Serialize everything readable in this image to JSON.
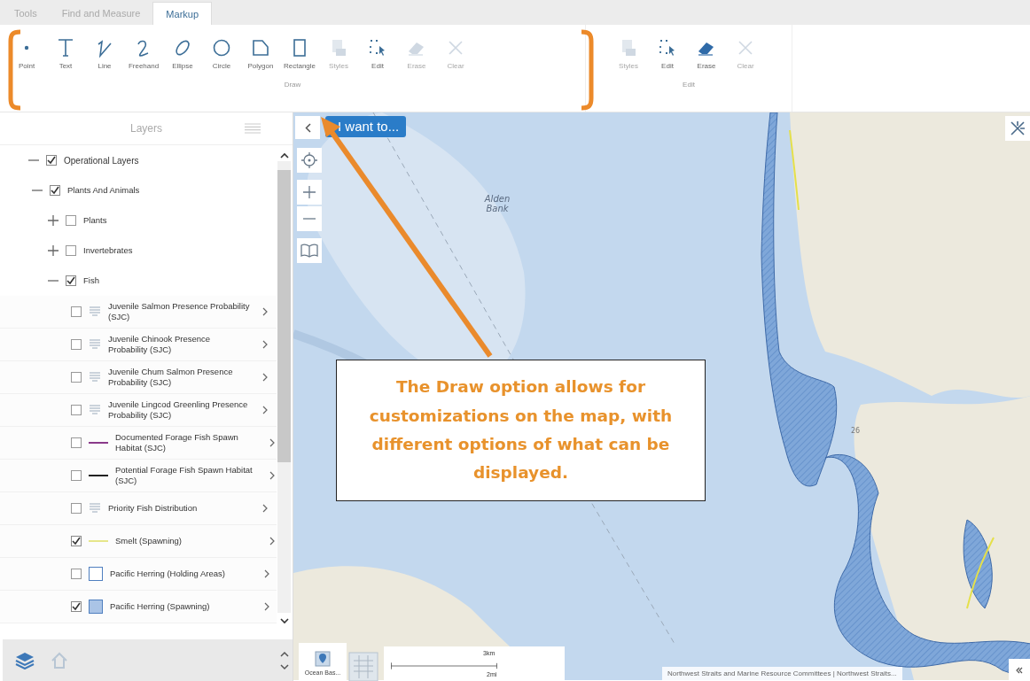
{
  "tabs": [
    {
      "label": "Tools",
      "selected": false
    },
    {
      "label": "Find and Measure",
      "selected": false
    },
    {
      "label": "Markup",
      "selected": true
    }
  ],
  "ribbon_groups": [
    {
      "label": "Draw",
      "buttons": [
        {
          "kind": "point",
          "label": "Point",
          "disabled": false
        },
        {
          "kind": "text",
          "label": "Text",
          "disabled": false
        },
        {
          "kind": "line",
          "label": "Line",
          "disabled": false
        },
        {
          "kind": "freehand",
          "label": "Freehand",
          "disabled": false
        },
        {
          "kind": "ellipse",
          "label": "Ellipse",
          "disabled": false
        },
        {
          "kind": "circle",
          "label": "Circle",
          "disabled": false
        },
        {
          "kind": "polygon",
          "label": "Polygon",
          "disabled": false
        },
        {
          "kind": "rectangle",
          "label": "Rectangle",
          "disabled": false
        },
        {
          "kind": "styles",
          "label": "Styles",
          "disabled": true
        },
        {
          "kind": "edit",
          "label": "Edit",
          "disabled": false
        },
        {
          "kind": "erase",
          "label": "Erase",
          "disabled": true
        },
        {
          "kind": "clear",
          "label": "Clear",
          "disabled": true
        }
      ]
    },
    {
      "label": "Edit",
      "buttons": [
        {
          "kind": "styles",
          "label": "Styles",
          "disabled": true
        },
        {
          "kind": "edit",
          "label": "Edit",
          "disabled": false
        },
        {
          "kind": "erase",
          "label": "Erase",
          "disabled": false
        },
        {
          "kind": "clear",
          "label": "Clear",
          "disabled": true
        }
      ]
    }
  ],
  "layers_panel": {
    "title": "Layers",
    "tree": [
      {
        "label": "Operational Layers",
        "checked": true,
        "expanded": true,
        "children": [
          {
            "label": "Plants And Animals",
            "checked": true,
            "expanded": true,
            "children": [
              {
                "label": "Plants",
                "checked": false,
                "expanded": false
              },
              {
                "label": "Invertebrates",
                "checked": false,
                "expanded": false
              },
              {
                "label": "Fish",
                "checked": true,
                "expanded": true,
                "children": [
                  {
                    "label": "Juvenile Salmon Presence Probability (SJC)",
                    "checked": false,
                    "kind": "list"
                  },
                  {
                    "label": "Juvenile Chinook Presence Probability (SJC)",
                    "checked": false,
                    "kind": "list"
                  },
                  {
                    "label": "Juvenile Chum Salmon Presence Probability (SJC)",
                    "checked": false,
                    "kind": "list"
                  },
                  {
                    "label": "Juvenile Lingcod Greenling Presence Probability (SJC)",
                    "checked": false,
                    "kind": "list"
                  },
                  {
                    "label": "Documented Forage Fish Spawn Habitat (SJC)",
                    "checked": false,
                    "kind": "line",
                    "color": "#8a3a8a"
                  },
                  {
                    "label": "Potential Forage Fish Spawn Habitat (SJC)",
                    "checked": false,
                    "kind": "line",
                    "color": "#222222"
                  },
                  {
                    "label": "Priority Fish Distribution",
                    "checked": false,
                    "kind": "list"
                  },
                  {
                    "label": "Smelt (Spawning)",
                    "checked": true,
                    "kind": "line",
                    "color": "#e6e68a"
                  },
                  {
                    "label": "Pacific Herring (Holding Areas)",
                    "checked": false,
                    "kind": "fill",
                    "color": "#ffffff"
                  },
                  {
                    "label": "Pacific Herring (Spawning)",
                    "checked": true,
                    "kind": "fill",
                    "color": "#aac4e6"
                  }
                ]
              }
            ]
          }
        ]
      }
    ]
  },
  "map": {
    "want_to_button": "I want to...",
    "labels": [
      "Alden Bank",
      "26"
    ],
    "basemaps": [
      {
        "label": "Ocean Bas..."
      }
    ],
    "scale": {
      "km": "3km",
      "mi": "2mi"
    },
    "attribution": "Northwest Straits and Marine Resource Committees | Northwest Straits..."
  },
  "callout": {
    "text": "The Draw option allows for customizations on the map, with different options of what can be displayed."
  }
}
